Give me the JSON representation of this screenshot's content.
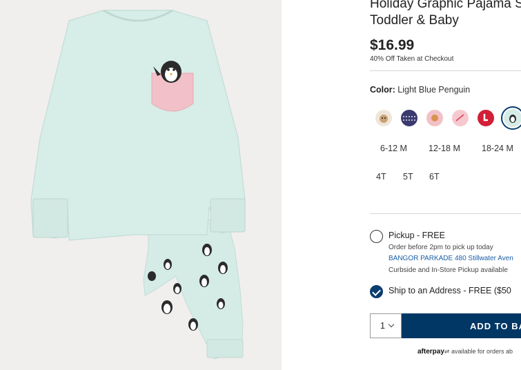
{
  "product": {
    "title_line1": "Holiday Graphic Pajama S",
    "title_line2": "Toddler & Baby",
    "price": "$16.99",
    "promo": "40% Off Taken at Checkout"
  },
  "color": {
    "label": "Color:",
    "value": "Light Blue Penguin",
    "swatch_colors": [
      "#efe6da",
      "#3a3a6e",
      "#f2c1c8",
      "#f6c8cf",
      "#d21f36",
      "#d6ece7"
    ]
  },
  "sizes": {
    "row1": [
      "6-12 M",
      "12-18 M",
      "18-24 M"
    ],
    "row2": [
      "4T",
      "5T",
      "6T"
    ]
  },
  "fulfillment": {
    "pickup_title": "Pickup - FREE",
    "pickup_note": "Order before 2pm to pick up today",
    "store": "BANGOR PARKADE 480 Stillwater Aven",
    "pickup_avail": "Curbside and In-Store Pickup available",
    "ship_title": "Ship to an Address - FREE ($50"
  },
  "cart": {
    "quantity": "1",
    "add_label": "ADD TO BA"
  },
  "afterpay": {
    "brand": "afterpay",
    "text": "available for orders ab"
  }
}
